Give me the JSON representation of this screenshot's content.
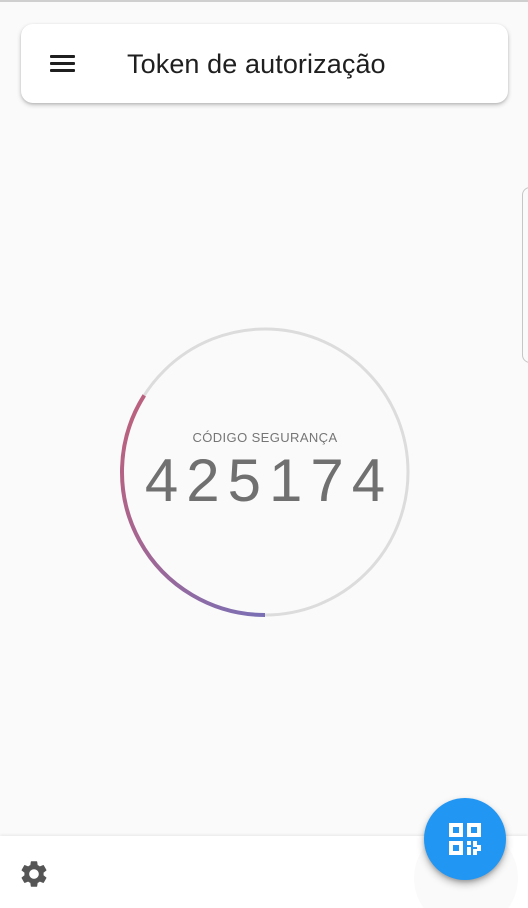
{
  "header": {
    "title": "Token de autorização",
    "menu_icon": "menu-icon"
  },
  "token": {
    "label": "CÓDIGO SEGURANÇA",
    "code": "425174",
    "time_remaining_fraction": 0.34,
    "ring_color": "#dcdcdc",
    "progress_color_start": "#c0607a",
    "progress_color_end": "#7a6fb5"
  },
  "bottom_bar": {
    "settings_icon": "gear-icon"
  },
  "fab": {
    "icon": "qr-code-icon",
    "color": "#2196f3"
  }
}
